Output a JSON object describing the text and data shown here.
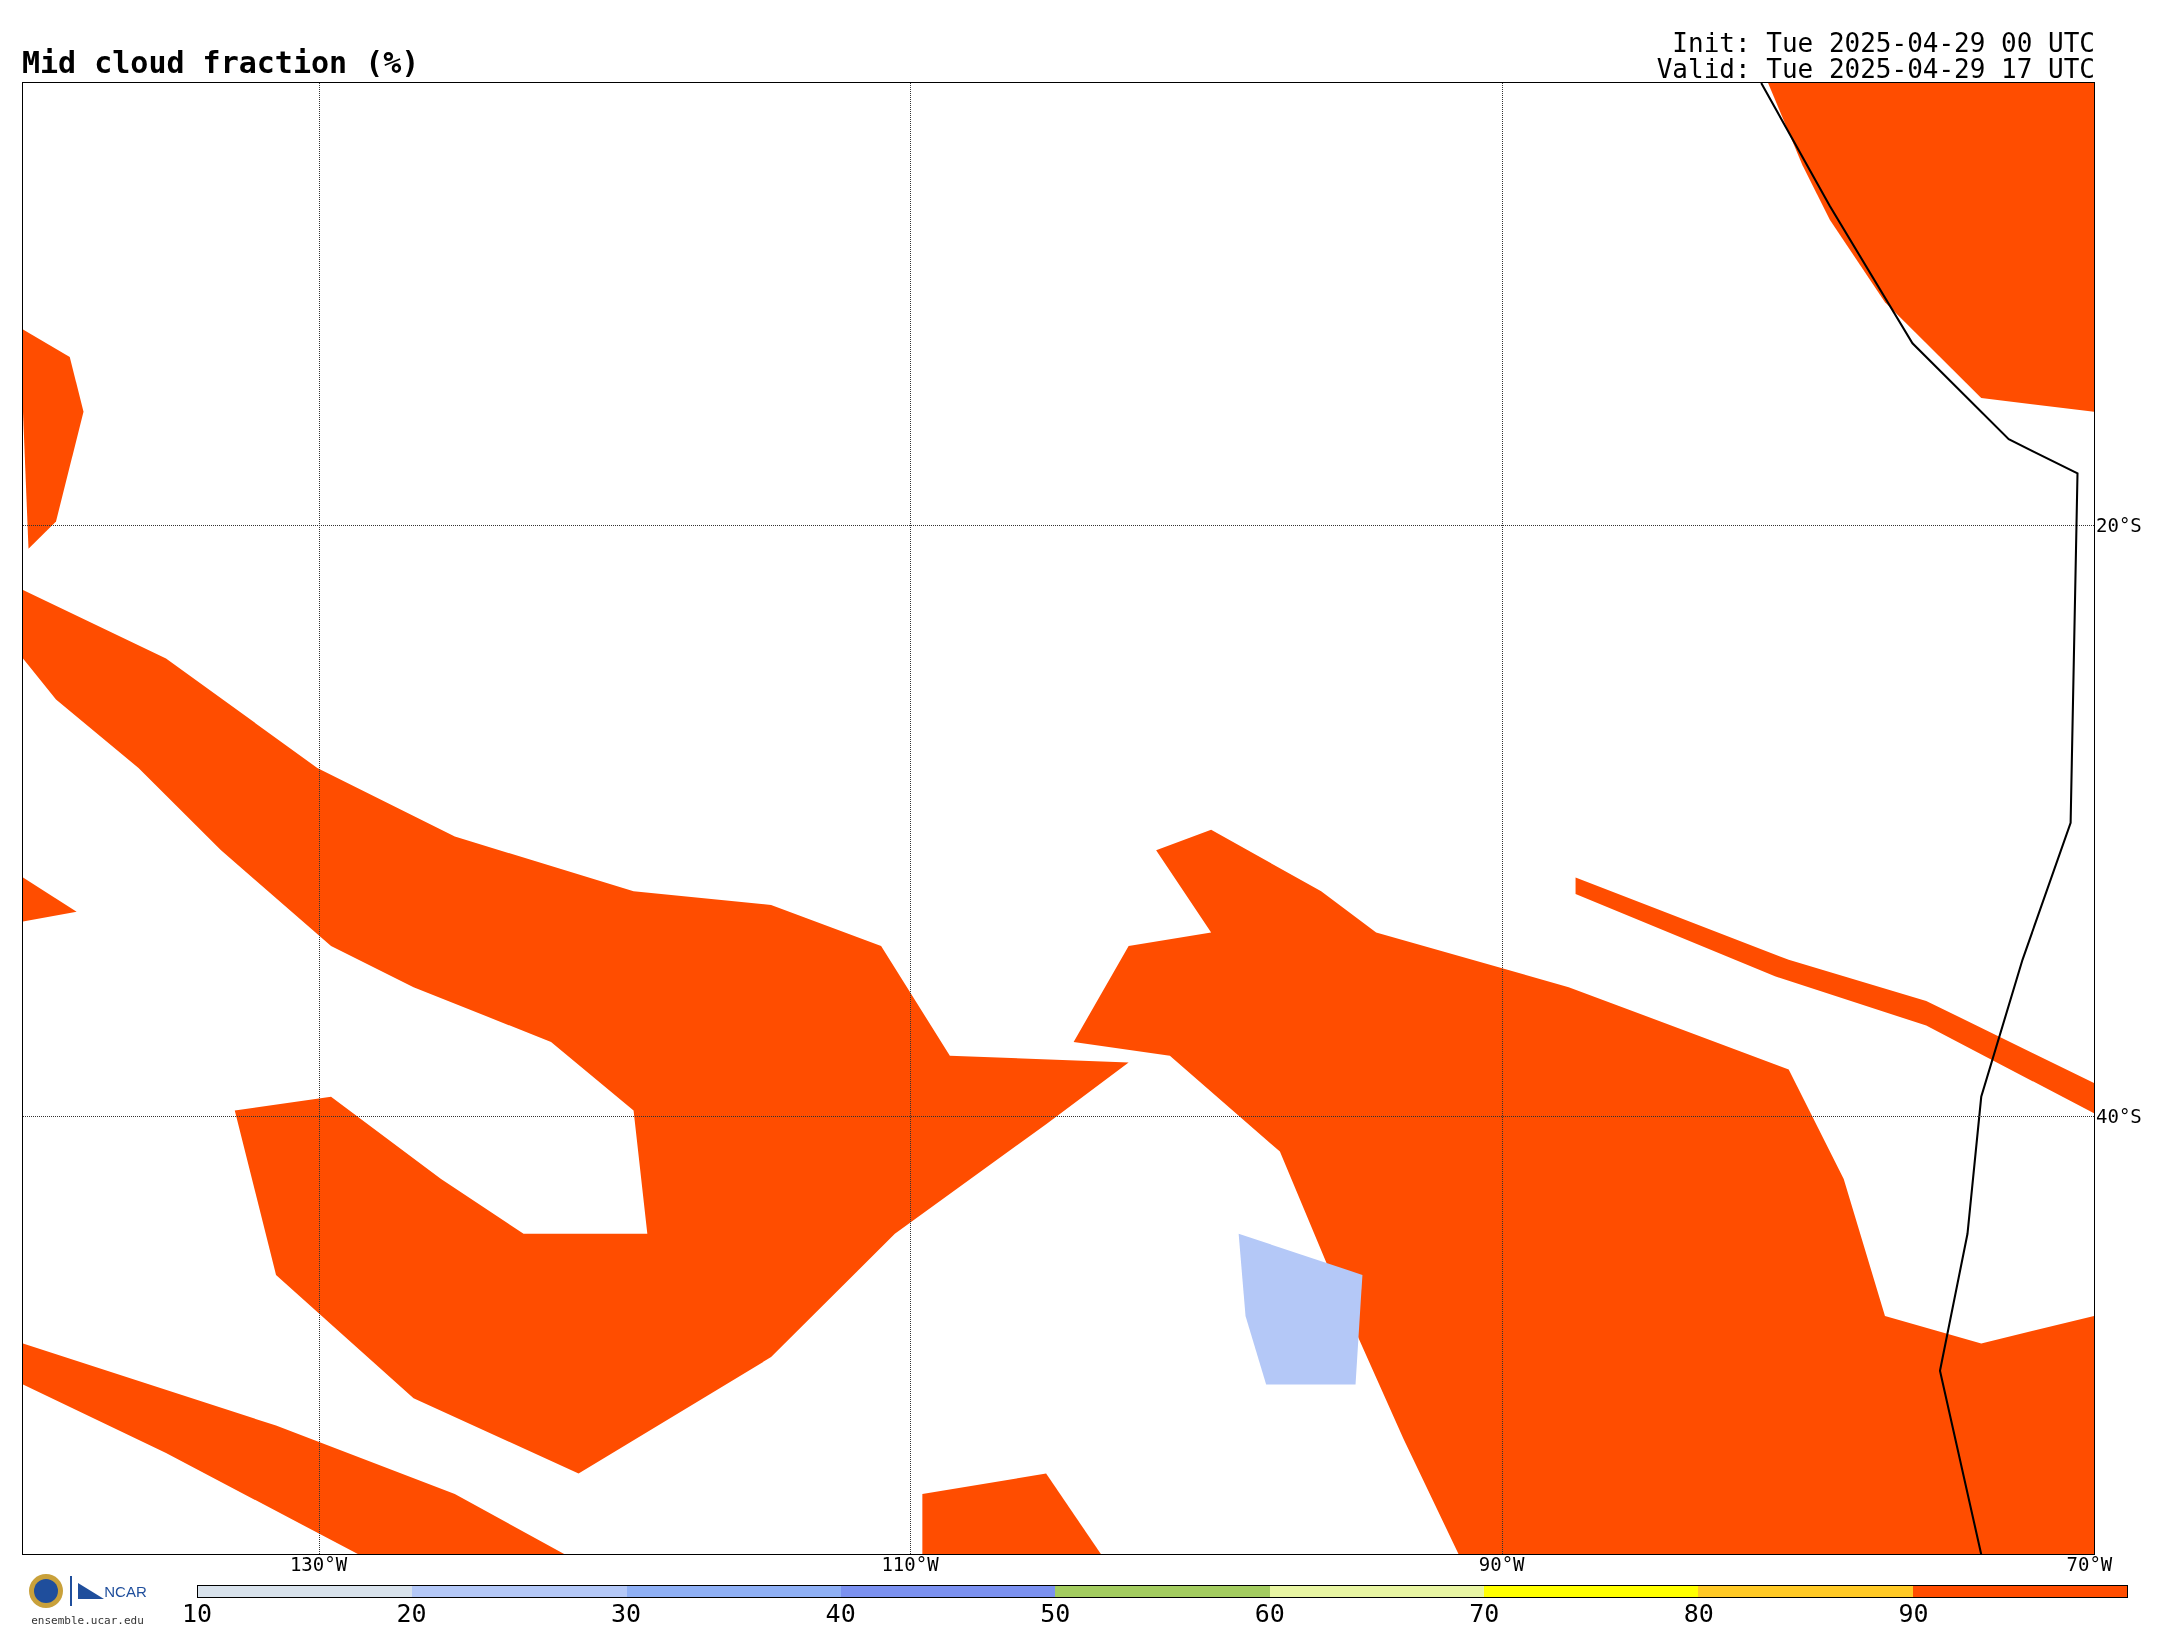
{
  "title": "Mid cloud fraction (%)",
  "run_times": [
    "Init: Tue 2025-04-29 00 UTC",
    "Valid: Tue 2025-04-29 17 UTC"
  ],
  "map": {
    "lat_labels": [
      "20°S",
      "40°S"
    ],
    "lon_labels": [
      "130°W",
      "110°W",
      "90°W",
      "70°W"
    ]
  },
  "logo": {
    "name": "NCAR",
    "url": "ensemble.ucar.edu"
  },
  "colorbar": {
    "segments": [
      {
        "color": "#d8e2ec"
      },
      {
        "color": "#b4c8f7"
      },
      {
        "color": "#8fb0f5"
      },
      {
        "color": "#7b91f0"
      },
      {
        "color": "#a3cc60"
      },
      {
        "color": "#e8f5a3"
      },
      {
        "color": "#ffff00"
      },
      {
        "color": "#ffc925"
      },
      {
        "color": "#ff4d00"
      }
    ],
    "ticks": [
      "10",
      "20",
      "30",
      "40",
      "50",
      "60",
      "70",
      "80",
      "90"
    ]
  }
}
